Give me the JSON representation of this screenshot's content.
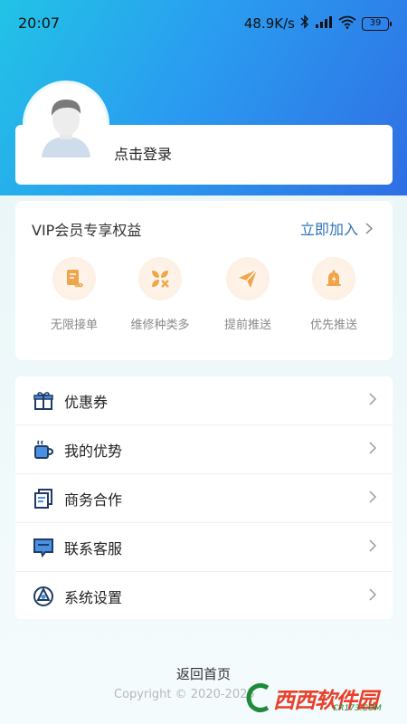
{
  "status_bar": {
    "time": "20:07",
    "network_speed": "48.9K/s",
    "battery": "39"
  },
  "profile": {
    "login_label": "点击登录"
  },
  "vip": {
    "title": "VIP会员专享权益",
    "join_label": "立即加入",
    "items": [
      {
        "label": "无限接单",
        "icon": "document-infinity-icon"
      },
      {
        "label": "维修种类多",
        "icon": "grid-clover-icon"
      },
      {
        "label": "提前推送",
        "icon": "paper-plane-icon"
      },
      {
        "label": "优先推送",
        "icon": "bell-icon"
      }
    ]
  },
  "menu": {
    "items": [
      {
        "label": "优惠券",
        "icon": "gift-icon"
      },
      {
        "label": "我的优势",
        "icon": "cup-icon"
      },
      {
        "label": "商务合作",
        "icon": "document-icon"
      },
      {
        "label": "联系客服",
        "icon": "chat-icon"
      },
      {
        "label": "系统设置",
        "icon": "settings-icon"
      }
    ]
  },
  "footer": {
    "back_home": "返回首页",
    "copyright": "Copyright © 2020-2025"
  },
  "watermark": {
    "text": "西西软件园",
    "sub": "CR173.COM"
  },
  "colors": {
    "header_start": "#22c3e6",
    "header_end": "#2f6fe4",
    "accent_blue": "#2e73b8",
    "vip_orange": "#f0a54a",
    "icon_navy": "#1f3b66",
    "icon_blue": "#4a90e2"
  }
}
